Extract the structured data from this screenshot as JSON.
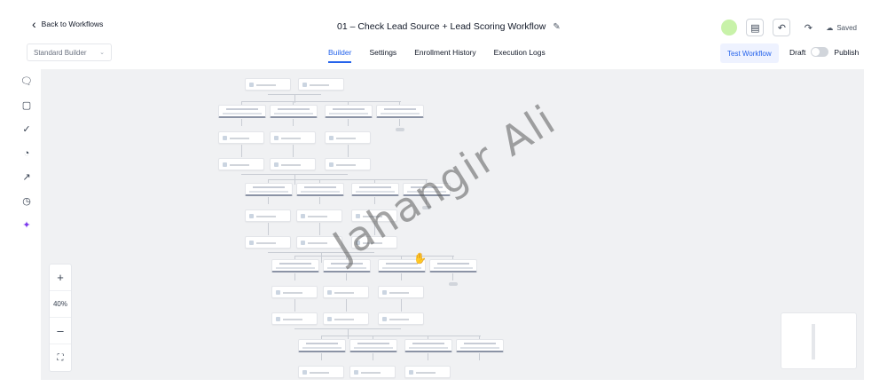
{
  "header": {
    "back_label": "Back to Workflows",
    "workflow_title": "01 – Check Lead Source + Lead Scoring Workflow",
    "saved_label": "Saved"
  },
  "toolbar": {
    "builder_mode": "Standard Builder",
    "tabs": [
      {
        "label": "Builder",
        "active": true
      },
      {
        "label": "Settings",
        "active": false
      },
      {
        "label": "Enrollment History",
        "active": false
      },
      {
        "label": "Execution Logs",
        "active": false
      }
    ],
    "test_workflow_label": "Test Workflow",
    "draft_label": "Draft",
    "publish_label": "Publish",
    "publish_enabled": false
  },
  "sidebar": {
    "icons": [
      "comment-icon",
      "file-icon",
      "check-circle-icon",
      "pie-chart-icon",
      "external-link-icon",
      "history-icon",
      "sparkle-icon"
    ]
  },
  "zoom": {
    "in_symbol": "+",
    "level": "40%",
    "out_symbol": "–",
    "fit_symbol": "⛶"
  },
  "watermark": "Jahangir Ali",
  "colors": {
    "accent": "#2563eb",
    "canvas": "#f0f1f3",
    "avatar": "#c8f2a9"
  }
}
